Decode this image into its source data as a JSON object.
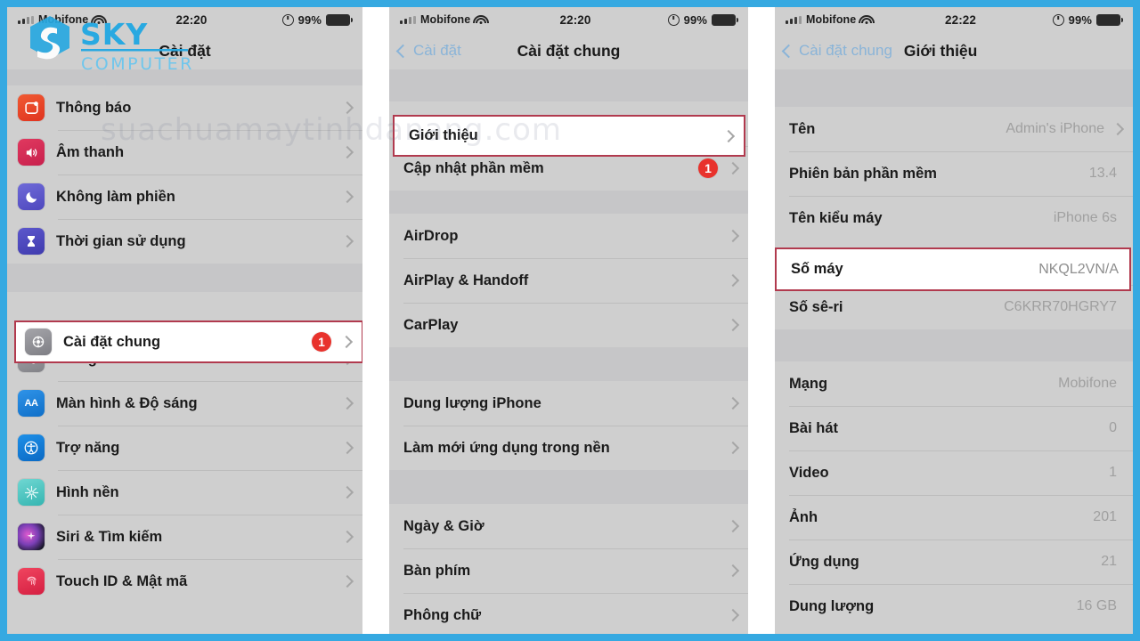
{
  "frame": {
    "border_color": "#36a9e1",
    "background": "#ffffff"
  },
  "watermark": {
    "site_text": "suachuamaytinhdanang.com",
    "logo_line1": "SKY",
    "logo_line2": "COMPUTER",
    "logo_color": "#29a9e1"
  },
  "panel1": {
    "status": {
      "carrier": "Mobifone",
      "time": "22:20",
      "battery_percent": "99%",
      "wifi_icon": "wifi-icon",
      "lock_icon": "rotation-lock-icon",
      "battery_icon": "battery-icon"
    },
    "nav": {
      "title": "Cài đặt"
    },
    "group1": [
      {
        "label": "Thông báo",
        "icon": "notifications-icon",
        "color": "#e8452c",
        "glyph": ""
      },
      {
        "label": "Âm thanh",
        "icon": "sounds-icon",
        "color": "#d6285a",
        "glyph": ""
      },
      {
        "label": "Không làm phiền",
        "icon": "do-not-disturb-icon",
        "color": "#5c57c8",
        "glyph": ""
      },
      {
        "label": "Thời gian sử dụng",
        "icon": "screen-time-icon",
        "color": "#4b48bd",
        "glyph": ""
      }
    ],
    "group2": [
      {
        "label": "Cài đặt chung",
        "icon": "general-settings-icon",
        "color": "#8e8e93",
        "badge": "1",
        "highlighted": true
      },
      {
        "label": "Trung tâm điều khiển",
        "icon": "control-center-icon",
        "color": "#8e8e93"
      },
      {
        "label": "Màn hình & Độ sáng",
        "icon": "display-brightness-icon",
        "color": "#1f7fdd",
        "glyph": "AA"
      },
      {
        "label": "Trợ năng",
        "icon": "accessibility-icon",
        "color": "#1484d6"
      },
      {
        "label": "Hình nền",
        "icon": "wallpaper-icon",
        "color": "#3fc0bd"
      },
      {
        "label": "Siri & Tìm kiếm",
        "icon": "siri-icon",
        "color": "#1b1b2e"
      },
      {
        "label": "Touch ID & Mật mã",
        "icon": "touch-id-icon",
        "color": "#e8334f"
      }
    ]
  },
  "panel2": {
    "status": {
      "carrier": "Mobifone",
      "time": "22:20",
      "battery_percent": "99%"
    },
    "nav": {
      "back": "Cài đặt",
      "title": "Cài đặt chung"
    },
    "group1": [
      {
        "label": "Giới thiệu",
        "highlighted": true
      },
      {
        "label": "Cập nhật phần mềm",
        "badge": "1"
      }
    ],
    "group2": [
      {
        "label": "AirDrop"
      },
      {
        "label": "AirPlay & Handoff"
      },
      {
        "label": "CarPlay"
      }
    ],
    "group3": [
      {
        "label": "Dung lượng iPhone"
      },
      {
        "label": "Làm mới ứng dụng trong nền"
      }
    ],
    "group4": [
      {
        "label": "Ngày & Giờ"
      },
      {
        "label": "Bàn phím"
      },
      {
        "label": "Phông chữ"
      }
    ]
  },
  "panel3": {
    "status": {
      "carrier": "Mobifone",
      "time": "22:22",
      "battery_percent": "99%"
    },
    "nav": {
      "back": "Cài đặt chung",
      "title": "Giới thiệu"
    },
    "group1": [
      {
        "label": "Tên",
        "value": "Admin's iPhone",
        "chevron": true
      },
      {
        "label": "Phiên bản phần mềm",
        "value": "13.4"
      },
      {
        "label": "Tên kiểu máy",
        "value": "iPhone 6s"
      },
      {
        "label": "Số máy",
        "value": "NKQL2VN/A",
        "highlighted": true
      },
      {
        "label": "Số sê-ri",
        "value": "C6KRR70HGRY7"
      }
    ],
    "group2": [
      {
        "label": "Mạng",
        "value": "Mobifone"
      },
      {
        "label": "Bài hát",
        "value": "0"
      },
      {
        "label": "Video",
        "value": "1"
      },
      {
        "label": "Ảnh",
        "value": "201"
      },
      {
        "label": "Ứng dụng",
        "value": "21"
      },
      {
        "label": "Dung lượng",
        "value": "16 GB"
      }
    ]
  }
}
